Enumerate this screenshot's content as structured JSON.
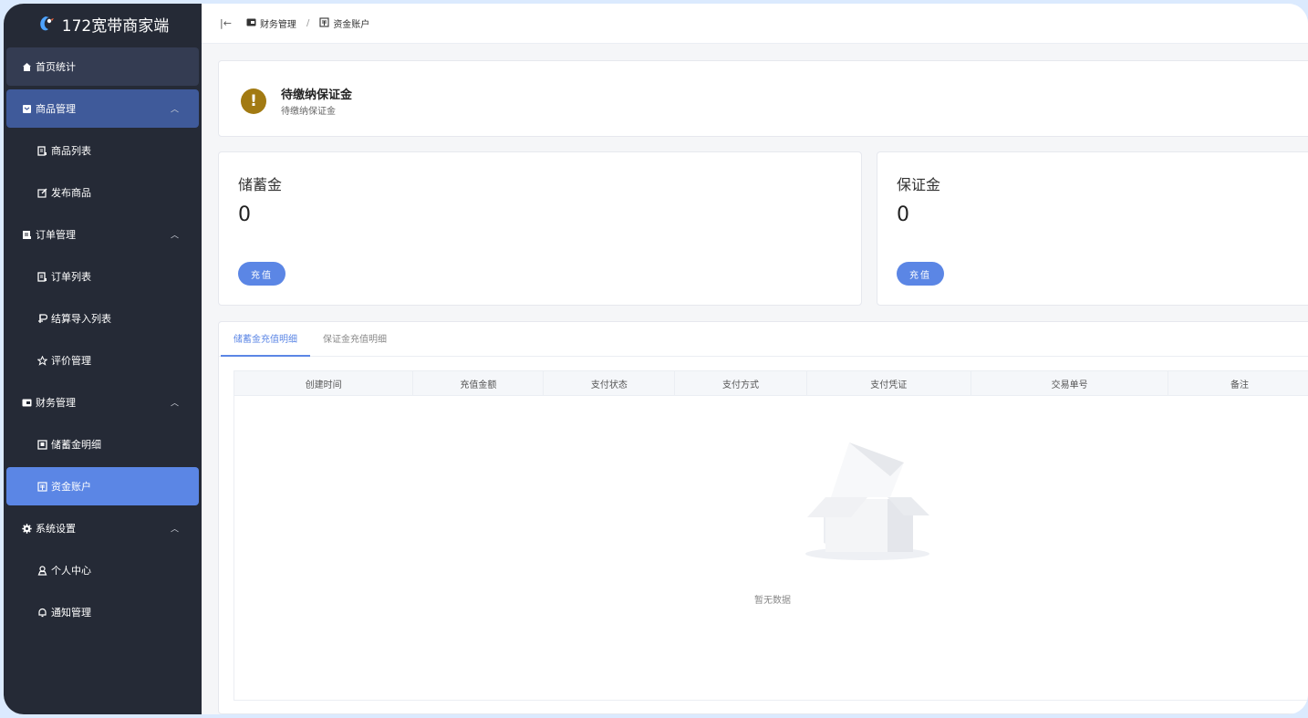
{
  "app": {
    "title": "172宽带商家端"
  },
  "sidebar": {
    "items": [
      {
        "label": "首页统计",
        "icon": "home-icon"
      },
      {
        "label": "商品管理",
        "icon": "goods-icon",
        "expanded": true
      },
      {
        "label": "商品列表",
        "icon": "list-icon"
      },
      {
        "label": "发布商品",
        "icon": "edit-icon"
      },
      {
        "label": "订单管理",
        "icon": "order-icon",
        "expanded": true
      },
      {
        "label": "订单列表",
        "icon": "list-icon"
      },
      {
        "label": "结算导入列表",
        "icon": "settle-icon"
      },
      {
        "label": "评价管理",
        "icon": "star-icon"
      },
      {
        "label": "财务管理",
        "icon": "wallet-icon",
        "expanded": true
      },
      {
        "label": "储蓄金明细",
        "icon": "ledger-icon"
      },
      {
        "label": "资金账户",
        "icon": "account-icon",
        "active": true
      },
      {
        "label": "系统设置",
        "icon": "gear-icon",
        "expanded": true
      },
      {
        "label": "个人中心",
        "icon": "user-icon"
      },
      {
        "label": "通知管理",
        "icon": "bell-icon"
      }
    ]
  },
  "header": {
    "breadcrumb": [
      {
        "label": "财务管理",
        "icon": "wallet-icon"
      },
      {
        "label": "资金账户",
        "icon": "account-icon"
      }
    ],
    "separator": "/"
  },
  "alert": {
    "title": "待缴纳保证金",
    "subtitle": "待缴纳保证金",
    "color": "#a27a12"
  },
  "balances": {
    "savings": {
      "label": "储蓄金",
      "value": "0",
      "button": "充值"
    },
    "deposit": {
      "label": "保证金",
      "value": "0",
      "button": "充值"
    }
  },
  "tabs": [
    {
      "label": "储蓄金充值明细",
      "active": true
    },
    {
      "label": "保证金充值明细",
      "active": false
    }
  ],
  "table": {
    "columns": [
      "创建时间",
      "充值金额",
      "支付状态",
      "支付方式",
      "支付凭证",
      "交易单号",
      "备注"
    ],
    "rows": [],
    "empty_text": "暂无数据"
  },
  "colors": {
    "sidebar_bg": "#252a36",
    "accent": "#5b86e5",
    "group_open": "#3f5a9a"
  }
}
